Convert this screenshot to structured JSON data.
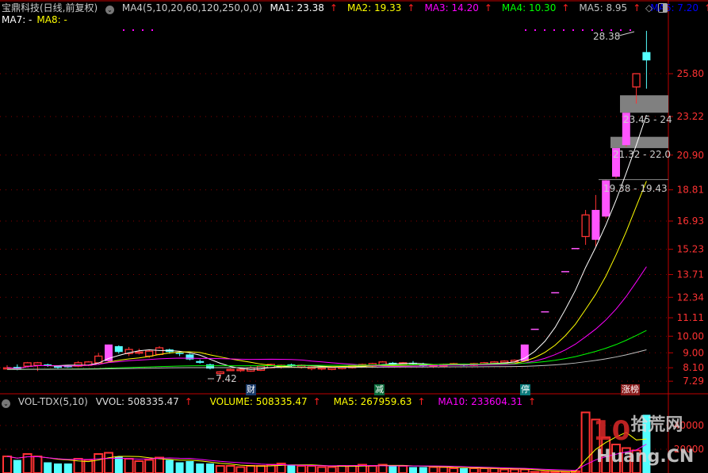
{
  "header": {
    "title": "宝鼎科技(日线,前复权)",
    "indicator": "MA4(5,10,20,60,120,250,0,0)",
    "ma": [
      {
        "label": "MA1: 23.38",
        "color": "#ffffff"
      },
      {
        "label": "MA2: 19.33",
        "color": "#ffff00"
      },
      {
        "label": "MA3: 14.20",
        "color": "#ff00ff"
      },
      {
        "label": "MA4: 10.30",
        "color": "#00ff00"
      },
      {
        "label": "MA5: 8.95",
        "color": "#c0c0c0"
      },
      {
        "label": "MA6: 7.20",
        "color": "#0000ff"
      }
    ],
    "ma_row2": [
      {
        "label": "MA7: -",
        "color": "#ffffff"
      },
      {
        "label": "MA8: -",
        "color": "#ffff00"
      }
    ],
    "up_arrow": "↑"
  },
  "volume_header": {
    "indicator": "VOL-TDX(5,10)",
    "vvol": "VVOL: 508335.47",
    "volume": "VOLUME: 508335.47",
    "ma5": "MA5: 267959.63",
    "ma10": "MA10: 233604.31"
  },
  "price_axis": [
    "25.80",
    "23.22",
    "20.90",
    "18.81",
    "16.93",
    "15.23",
    "13.71",
    "12.34",
    "11.11",
    "10.00",
    "9.00",
    "8.10",
    "7.29"
  ],
  "volume_axis": [
    "40000",
    "20000"
  ],
  "annotations": {
    "high": "28.38",
    "low": "7.42",
    "gap1": "23.45 - 24",
    "gap2": "21.32 - 22.0",
    "gap3": "19.38 - 19.43"
  },
  "markers": {
    "cai": "财",
    "jian": "减",
    "ting": "停",
    "zhangbang": "涨榜"
  },
  "watermark": "10 拾荒网 Huang.CN",
  "colors": {
    "up": "#ff3232",
    "limit_up": "#ff55ff",
    "down": "#54ffff",
    "grid": "#8b0000",
    "axis_text": "#ff3232"
  },
  "chart_data": {
    "type": "candlestick",
    "price_scale": "linear",
    "candles": [
      [
        8.1,
        8.25,
        8.0,
        8.1,
        14000
      ],
      [
        8.15,
        8.3,
        7.95,
        8.0,
        11000
      ],
      [
        8.2,
        8.45,
        8.15,
        8.4,
        16000
      ],
      [
        8.25,
        8.45,
        7.9,
        8.4,
        14000
      ],
      [
        8.3,
        8.35,
        8.15,
        8.25,
        9000
      ],
      [
        8.2,
        8.25,
        8.05,
        8.1,
        8000
      ],
      [
        8.2,
        8.25,
        8.1,
        8.15,
        8000
      ],
      [
        8.2,
        8.5,
        8.15,
        8.4,
        12000
      ],
      [
        8.25,
        8.5,
        8.2,
        8.45,
        11000
      ],
      [
        8.4,
        9.0,
        8.35,
        8.8,
        16000
      ],
      [
        8.5,
        9.5,
        8.45,
        9.5,
        17000
      ],
      [
        9.4,
        9.45,
        8.95,
        9.05,
        14000
      ],
      [
        8.95,
        9.35,
        8.8,
        9.2,
        12000
      ],
      [
        9.0,
        9.25,
        8.9,
        9.05,
        10000
      ],
      [
        8.8,
        9.2,
        8.7,
        9.1,
        11000
      ],
      [
        8.9,
        9.4,
        8.85,
        9.3,
        13000
      ],
      [
        9.2,
        9.25,
        8.95,
        9.05,
        11000
      ],
      [
        9.0,
        9.1,
        8.8,
        8.95,
        9000
      ],
      [
        8.9,
        8.95,
        8.55,
        8.6,
        10000
      ],
      [
        8.5,
        8.6,
        8.35,
        8.4,
        8000
      ],
      [
        8.3,
        8.35,
        8.0,
        8.05,
        8000
      ],
      [
        7.75,
        7.9,
        7.42,
        7.85,
        6000
      ],
      [
        8.0,
        8.05,
        7.95,
        8.0,
        6000
      ],
      [
        7.95,
        8.05,
        7.85,
        8.0,
        5000
      ],
      [
        7.9,
        8.2,
        7.85,
        8.1,
        6000
      ],
      [
        7.95,
        8.25,
        7.9,
        8.2,
        6000
      ],
      [
        8.1,
        8.35,
        8.05,
        8.3,
        7000
      ],
      [
        8.15,
        8.3,
        8.05,
        8.25,
        8000
      ],
      [
        8.3,
        8.35,
        8.1,
        8.2,
        7000
      ],
      [
        8.15,
        8.3,
        8.05,
        8.25,
        6000
      ],
      [
        8.05,
        8.2,
        7.95,
        8.15,
        6000
      ],
      [
        8.05,
        8.15,
        7.95,
        8.1,
        5000
      ],
      [
        8.0,
        8.15,
        7.95,
        8.1,
        5000
      ],
      [
        8.05,
        8.2,
        8.0,
        8.15,
        6000
      ],
      [
        8.1,
        8.25,
        8.05,
        8.2,
        6000
      ],
      [
        8.15,
        8.35,
        8.1,
        8.3,
        7000
      ],
      [
        8.2,
        8.4,
        8.15,
        8.35,
        6000
      ],
      [
        8.25,
        8.5,
        8.2,
        8.45,
        7000
      ],
      [
        8.4,
        8.45,
        8.25,
        8.3,
        6000
      ],
      [
        8.3,
        8.45,
        8.25,
        8.4,
        6000
      ],
      [
        8.4,
        8.5,
        8.3,
        8.35,
        5000
      ],
      [
        8.3,
        8.4,
        8.15,
        8.2,
        5000
      ],
      [
        8.2,
        8.3,
        8.1,
        8.25,
        5000
      ],
      [
        8.2,
        8.35,
        8.15,
        8.3,
        5000
      ],
      [
        8.3,
        8.4,
        8.25,
        8.35,
        4000
      ],
      [
        8.3,
        8.35,
        8.2,
        8.25,
        4000
      ],
      [
        8.25,
        8.4,
        8.2,
        8.35,
        4000
      ],
      [
        8.3,
        8.45,
        8.25,
        8.4,
        4000
      ],
      [
        8.35,
        8.5,
        8.3,
        8.45,
        4000
      ],
      [
        8.4,
        8.55,
        8.35,
        8.5,
        3000
      ],
      [
        8.45,
        8.6,
        8.4,
        8.55,
        3000
      ],
      [
        8.5,
        9.5,
        8.5,
        9.5,
        3000
      ],
      [
        10.45,
        10.45,
        10.45,
        10.45,
        1000
      ],
      [
        11.5,
        11.5,
        11.5,
        11.5,
        1000
      ],
      [
        12.65,
        12.65,
        12.65,
        12.65,
        1000
      ],
      [
        13.92,
        13.92,
        13.92,
        13.92,
        1000
      ],
      [
        15.31,
        15.31,
        15.31,
        15.31,
        1500
      ],
      [
        16.0,
        17.6,
        15.5,
        17.3,
        51000
      ],
      [
        15.8,
        18.5,
        15.4,
        17.6,
        45000
      ],
      [
        17.2,
        19.4,
        17.1,
        19.38,
        30000
      ],
      [
        19.6,
        21.32,
        19.5,
        21.32,
        24000
      ],
      [
        21.5,
        23.45,
        21.4,
        23.45,
        21000
      ],
      [
        25.0,
        25.8,
        24.0,
        25.8,
        19000
      ],
      [
        27.1,
        28.38,
        24.9,
        26.6,
        49000
      ]
    ],
    "limit_up_days": [
      10,
      51,
      52,
      53,
      54,
      55,
      56,
      58,
      59,
      60,
      61
    ],
    "ma_periods": [
      5,
      10,
      20,
      60,
      120
    ]
  }
}
